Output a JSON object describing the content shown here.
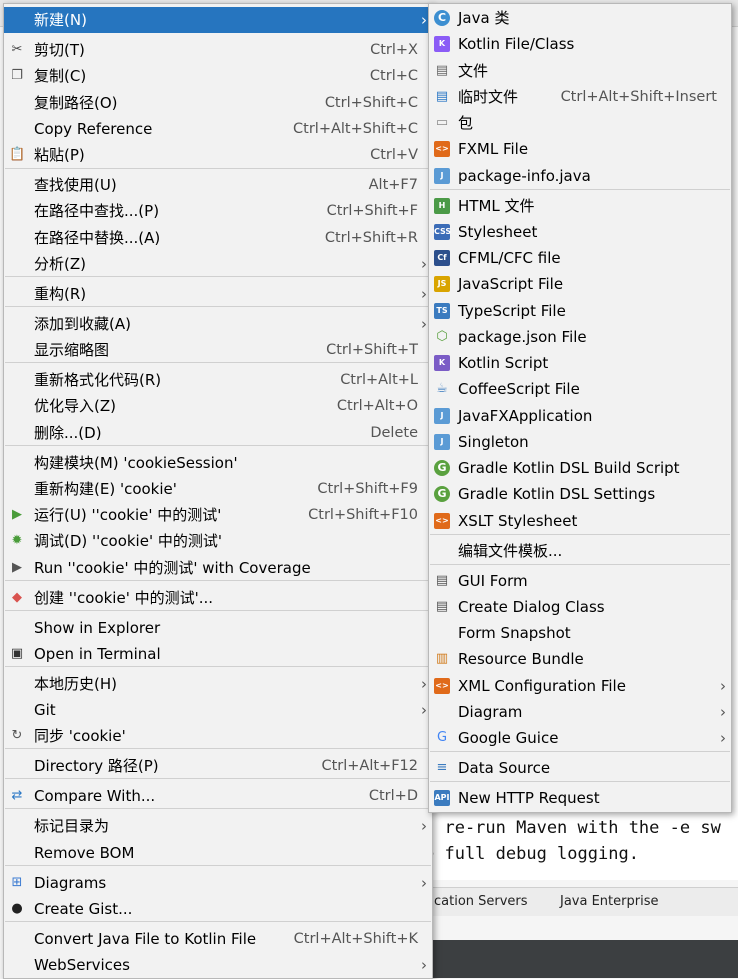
{
  "main_menu": {
    "items": [
      {
        "label": "新建(N)",
        "shortcut": "",
        "icon": "",
        "submenu": true,
        "highlighted": true
      },
      {
        "label": "剪切(T)",
        "shortcut": "Ctrl+X",
        "icon": "scissors-icon"
      },
      {
        "label": "复制(C)",
        "shortcut": "Ctrl+C",
        "icon": "copy-icon"
      },
      {
        "label": "复制路径(O)",
        "shortcut": "Ctrl+Shift+C",
        "icon": ""
      },
      {
        "label": "Copy Reference",
        "shortcut": "Ctrl+Alt+Shift+C",
        "icon": ""
      },
      {
        "label": "粘贴(P)",
        "shortcut": "Ctrl+V",
        "icon": "paste-icon"
      },
      {
        "label": "查找使用(U)",
        "shortcut": "Alt+F7",
        "icon": ""
      },
      {
        "label": "在路径中查找...(P)",
        "shortcut": "Ctrl+Shift+F",
        "icon": ""
      },
      {
        "label": "在路径中替换...(A)",
        "shortcut": "Ctrl+Shift+R",
        "icon": ""
      },
      {
        "label": "分析(Z)",
        "shortcut": "",
        "icon": "",
        "submenu": true
      },
      {
        "label": "重构(R)",
        "shortcut": "",
        "icon": "",
        "submenu": true
      },
      {
        "label": "添加到收藏(A)",
        "shortcut": "",
        "icon": "",
        "submenu": true
      },
      {
        "label": "显示缩略图",
        "shortcut": "Ctrl+Shift+T",
        "icon": ""
      },
      {
        "label": "重新格式化代码(R)",
        "shortcut": "Ctrl+Alt+L",
        "icon": ""
      },
      {
        "label": "优化导入(Z)",
        "shortcut": "Ctrl+Alt+O",
        "icon": ""
      },
      {
        "label": "删除...(D)",
        "shortcut": "Delete",
        "icon": ""
      },
      {
        "label": "构建模块(M) 'cookieSession'",
        "shortcut": "",
        "icon": ""
      },
      {
        "label": "重新构建(E) 'cookie'",
        "shortcut": "Ctrl+Shift+F9",
        "icon": ""
      },
      {
        "label": "运行(U) ''cookie' 中的测试'",
        "shortcut": "Ctrl+Shift+F10",
        "icon": "run-icon"
      },
      {
        "label": "调试(D) ''cookie' 中的测试'",
        "shortcut": "",
        "icon": "debug-icon"
      },
      {
        "label": "Run ''cookie' 中的测试' with Coverage",
        "shortcut": "",
        "icon": "coverage-icon"
      },
      {
        "label": "创建 ''cookie' 中的测试'...",
        "shortcut": "",
        "icon": "create-test-icon"
      },
      {
        "label": "Show in Explorer",
        "shortcut": "",
        "icon": ""
      },
      {
        "label": "Open in Terminal",
        "shortcut": "",
        "icon": "terminal-icon"
      },
      {
        "label": "本地历史(H)",
        "shortcut": "",
        "icon": "",
        "submenu": true
      },
      {
        "label": "Git",
        "shortcut": "",
        "icon": "",
        "submenu": true
      },
      {
        "label": "同步 'cookie'",
        "shortcut": "",
        "icon": "sync-icon"
      },
      {
        "label": "Directory 路径(P)",
        "shortcut": "Ctrl+Alt+F12",
        "icon": ""
      },
      {
        "label": "Compare With...",
        "shortcut": "Ctrl+D",
        "icon": "compare-icon"
      },
      {
        "label": "标记目录为",
        "shortcut": "",
        "icon": "",
        "submenu": true
      },
      {
        "label": "Remove BOM",
        "shortcut": "",
        "icon": ""
      },
      {
        "label": "Diagrams",
        "shortcut": "",
        "icon": "diagrams-icon",
        "submenu": true
      },
      {
        "label": "Create Gist...",
        "shortcut": "",
        "icon": "github-icon"
      },
      {
        "label": "Convert Java File to Kotlin File",
        "shortcut": "Ctrl+Alt+Shift+K",
        "icon": ""
      },
      {
        "label": "WebServices",
        "shortcut": "",
        "icon": "",
        "submenu": true
      }
    ]
  },
  "sub_menu": {
    "items": [
      {
        "label": "Java 类",
        "shortcut": "",
        "icon": "java-class-icon"
      },
      {
        "label": "Kotlin File/Class",
        "shortcut": "",
        "icon": "kotlin-icon"
      },
      {
        "label": "文件",
        "shortcut": "",
        "icon": "file-icon"
      },
      {
        "label": "临时文件",
        "shortcut": "Ctrl+Alt+Shift+Insert",
        "icon": "scratch-file-icon"
      },
      {
        "label": "包",
        "shortcut": "",
        "icon": "package-icon"
      },
      {
        "label": "FXML File",
        "shortcut": "",
        "icon": "fxml-icon"
      },
      {
        "label": "package-info.java",
        "shortcut": "",
        "icon": "package-info-icon"
      },
      {
        "label": "HTML 文件",
        "shortcut": "",
        "icon": "html-icon"
      },
      {
        "label": "Stylesheet",
        "shortcut": "",
        "icon": "css-icon"
      },
      {
        "label": "CFML/CFC file",
        "shortcut": "",
        "icon": "cfml-icon"
      },
      {
        "label": "JavaScript File",
        "shortcut": "",
        "icon": "javascript-icon"
      },
      {
        "label": "TypeScript File",
        "shortcut": "",
        "icon": "typescript-icon"
      },
      {
        "label": "package.json File",
        "shortcut": "",
        "icon": "nodejs-icon"
      },
      {
        "label": "Kotlin Script",
        "shortcut": "",
        "icon": "kotlin-script-icon"
      },
      {
        "label": "CoffeeScript File",
        "shortcut": "",
        "icon": "coffeescript-icon"
      },
      {
        "label": "JavaFXApplication",
        "shortcut": "",
        "icon": "javafx-icon"
      },
      {
        "label": "Singleton",
        "shortcut": "",
        "icon": "singleton-icon"
      },
      {
        "label": "Gradle Kotlin DSL Build Script",
        "shortcut": "",
        "icon": "gradle-icon"
      },
      {
        "label": "Gradle Kotlin DSL Settings",
        "shortcut": "",
        "icon": "gradle-icon"
      },
      {
        "label": "XSLT Stylesheet",
        "shortcut": "",
        "icon": "xslt-icon"
      },
      {
        "label": "编辑文件模板...",
        "shortcut": "",
        "icon": ""
      },
      {
        "label": "GUI Form",
        "shortcut": "",
        "icon": "gui-form-icon"
      },
      {
        "label": "Create Dialog Class",
        "shortcut": "",
        "icon": "dialog-class-icon"
      },
      {
        "label": "Form Snapshot",
        "shortcut": "",
        "icon": ""
      },
      {
        "label": "Resource Bundle",
        "shortcut": "",
        "icon": "resource-bundle-icon"
      },
      {
        "label": "XML Configuration File",
        "shortcut": "",
        "icon": "xml-config-icon",
        "submenu": true
      },
      {
        "label": "Diagram",
        "shortcut": "",
        "icon": "",
        "submenu": true
      },
      {
        "label": "Google Guice",
        "shortcut": "",
        "icon": "google-icon",
        "submenu": true
      },
      {
        "label": "Data Source",
        "shortcut": "",
        "icon": "database-icon"
      },
      {
        "label": "New HTTP Request",
        "shortcut": "",
        "icon": "api-icon"
      }
    ]
  },
  "background": {
    "console_line1": ", re-run Maven with the -e sw",
    "console_line2": "e full debug logging.",
    "tool_tab1": "cation Servers",
    "tool_tab2": "Java Enterprise"
  },
  "colors": {
    "highlight": "#2675bf",
    "menu_bg": "#f2f2f2"
  }
}
